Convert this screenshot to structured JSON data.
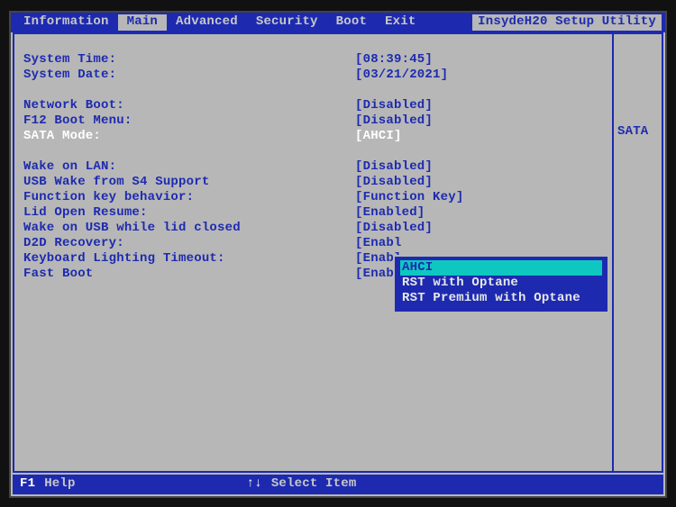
{
  "brand": "InsydeH20 Setup Utility",
  "menu": {
    "information": "Information",
    "main": "Main",
    "advanced": "Advanced",
    "security": "Security",
    "boot": "Boot",
    "exit": "Exit",
    "active": "main"
  },
  "settings": {
    "system_time": {
      "label": "System Time:",
      "value": "[08:39:45]"
    },
    "system_date": {
      "label": "System Date:",
      "value": "[03/21/2021]"
    },
    "network_boot": {
      "label": "Network Boot:",
      "value": "[Disabled]"
    },
    "f12_boot_menu": {
      "label": "F12 Boot Menu:",
      "value": "[Disabled]"
    },
    "sata_mode": {
      "label": "SATA Mode:",
      "value": "[AHCI]"
    },
    "wake_on_lan": {
      "label": "Wake on LAN:",
      "value": "[Disabled]"
    },
    "usb_wake_s4": {
      "label": "USB Wake from S4 Support",
      "value": "[Disabled]"
    },
    "fn_key_behavior": {
      "label": "Function key behavior:",
      "value": "[Function Key]"
    },
    "lid_open_resume": {
      "label": "Lid Open Resume:",
      "value": "[Enabled]"
    },
    "wake_usb_lid_closed": {
      "label": "Wake on USB while lid closed",
      "value": "[Disabled]"
    },
    "d2d_recovery": {
      "label": "D2D Recovery:",
      "value": "[Enabl"
    },
    "kb_light_timeout": {
      "label": "Keyboard Lighting Timeout:",
      "value": "[Enabl"
    },
    "fast_boot": {
      "label": "Fast Boot",
      "value": "[Enabl"
    }
  },
  "help_panel": {
    "text": "SATA"
  },
  "popup": {
    "options": {
      "ahci": "AHCI",
      "rst_optane": "RST with Optane",
      "rst_premium": "RST Premium with Optane"
    },
    "selected": "ahci"
  },
  "footer": {
    "f1_key": "F1",
    "f1_label": "Help",
    "nav_key": "↑↓",
    "nav_label": "Select Item"
  }
}
